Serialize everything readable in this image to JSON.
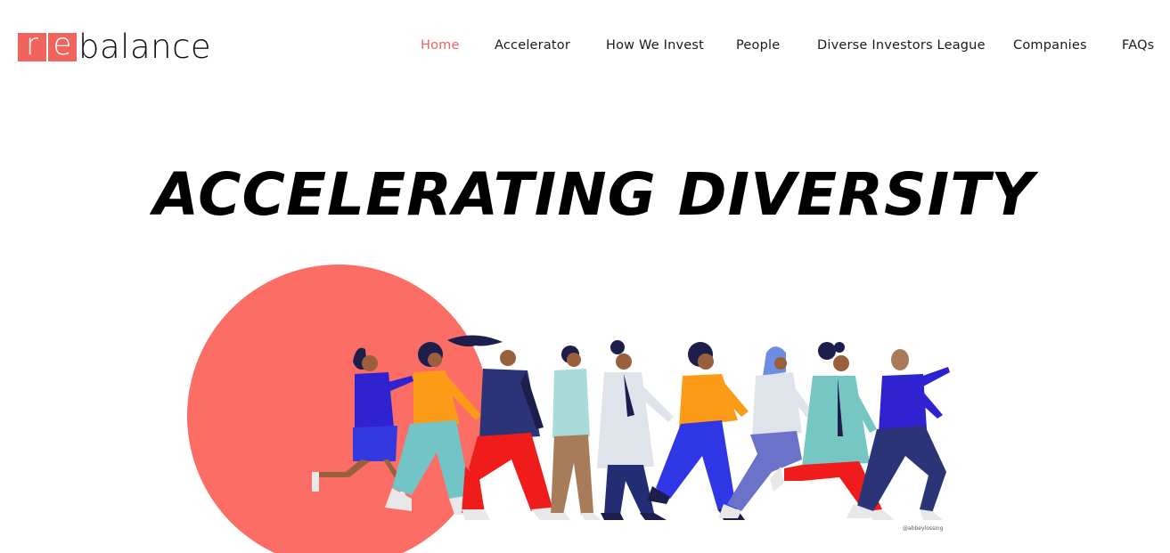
{
  "brand": {
    "logo_part1": "r",
    "logo_part2": "e",
    "logo_rest": "balance",
    "accent_color": "#f0645d",
    "text_color": "#111111"
  },
  "nav": {
    "items": [
      {
        "label": "Home",
        "active": true
      },
      {
        "label": "Accelerator",
        "active": false
      },
      {
        "label": "How We Invest",
        "active": false
      },
      {
        "label": "People",
        "active": false
      },
      {
        "label": "Diverse Investors League",
        "active": false
      },
      {
        "label": "Companies",
        "active": false
      },
      {
        "label": "FAQs",
        "active": false
      }
    ]
  },
  "hero": {
    "title": "ACCELERATING DIVERSITY",
    "illustration_credit": "@abbeylossing",
    "circle_color": "#fc6d66"
  }
}
